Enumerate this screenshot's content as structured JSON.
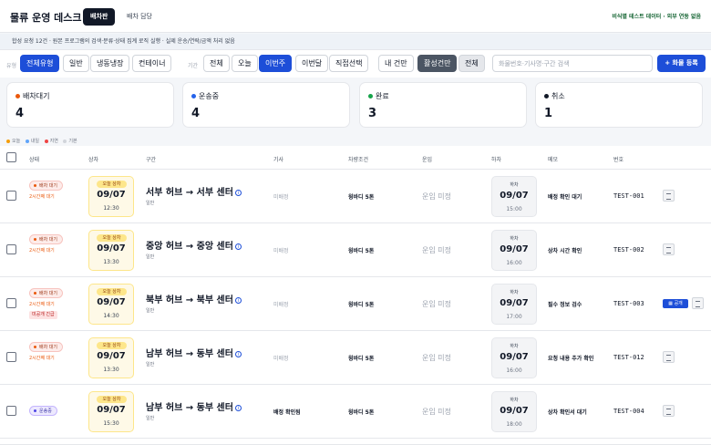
{
  "header": {
    "title": "물류 운영 데스크",
    "tabs": [
      "배차판",
      "배차 담당"
    ],
    "right_text": "비식별 테스트 데이터 · 외부 연동 없음"
  },
  "notice": "합성 요청 12건 · 원본 프로그램의 검색·분류·상태 집계 로직 실행 · 실제 운송/연락/금액 처리 없음",
  "filters": {
    "type_label": "유형",
    "type_options": [
      "전체유형",
      "일반",
      "냉동냉장",
      "컨테이너"
    ],
    "period_label": "기간",
    "period_options": [
      "전체",
      "오늘",
      "이번주",
      "이번달",
      "직접선택"
    ],
    "scope_options": [
      "내 건만",
      "활성건만",
      "전체"
    ],
    "search_placeholder": "화물번호·기사명·구간 검색",
    "add_button": "+ 화물 등록"
  },
  "summary": [
    {
      "label": "배차대기",
      "value": "4",
      "color": "#ea580c"
    },
    {
      "label": "운송중",
      "value": "4",
      "color": "#2563eb"
    },
    {
      "label": "완료",
      "value": "3",
      "color": "#16a34a"
    },
    {
      "label": "취소",
      "value": "1",
      "color": "#111827"
    }
  ],
  "legend": [
    {
      "label": "오늘",
      "color": "#f59e0b"
    },
    {
      "label": "내일",
      "color": "#60a5fa"
    },
    {
      "label": "지연",
      "color": "#ef4444"
    },
    {
      "label": "기본",
      "color": "#d1d5db"
    }
  ],
  "columns": [
    "상태",
    "상차",
    "구간",
    "기사",
    "차량조건",
    "운임",
    "하차",
    "메모",
    "번호"
  ],
  "rows": [
    {
      "status": "배차 대기",
      "elapsed": "2시간째 대기",
      "urgent": "",
      "pickup_tag": "오늘 상차",
      "pickup_date": "09/07",
      "pickup_time": "12:30",
      "route": "서부 허브 → 서부 센터",
      "route_type": "일반",
      "driver": "미배정",
      "vehicle": "윙바디 5톤",
      "fare": "운임 미정",
      "drop_tag": "하차",
      "drop_date": "09/07",
      "drop_time": "15:00",
      "memo": "배정 확인 대기",
      "code": "TEST-001",
      "share": ""
    },
    {
      "status": "배차 대기",
      "elapsed": "2시간째 대기",
      "urgent": "",
      "pickup_tag": "오늘 상차",
      "pickup_date": "09/07",
      "pickup_time": "13:30",
      "route": "중앙 허브 → 중앙 센터",
      "route_type": "일반",
      "driver": "미배정",
      "vehicle": "윙바디 5톤",
      "fare": "운임 미정",
      "drop_tag": "하차",
      "drop_date": "09/07",
      "drop_time": "16:00",
      "memo": "상차 시간 확인",
      "code": "TEST-002",
      "share": ""
    },
    {
      "status": "배차 대기",
      "elapsed": "2시간째 대기",
      "urgent": "미공개 긴급",
      "pickup_tag": "오늘 상차",
      "pickup_date": "09/07",
      "pickup_time": "14:30",
      "route": "북부 허브 → 북부 센터",
      "route_type": "일반",
      "driver": "미배정",
      "vehicle": "윙바디 5톤",
      "fare": "운임 미정",
      "drop_tag": "하차",
      "drop_date": "09/07",
      "drop_time": "17:00",
      "memo": "필수 정보 검수",
      "code": "TEST-003",
      "share": "공개"
    },
    {
      "status": "배차 대기",
      "elapsed": "2시간째 대기",
      "urgent": "",
      "pickup_tag": "오늘 상차",
      "pickup_date": "09/07",
      "pickup_time": "13:30",
      "route": "남부 허브 → 동부 센터",
      "route_type": "일반",
      "driver": "미배정",
      "vehicle": "윙바디 5톤",
      "fare": "운임 미정",
      "drop_tag": "하차",
      "drop_date": "09/07",
      "drop_time": "16:00",
      "memo": "요청 내용 추가 확인",
      "code": "TEST-012",
      "share": ""
    },
    {
      "status": "운송중",
      "elapsed": "",
      "urgent": "",
      "pickup_tag": "오늘 상차",
      "pickup_date": "09/07",
      "pickup_time": "15:30",
      "route": "남부 허브 → 동부 센터",
      "route_type": "일반",
      "driver": "배정 확인됨",
      "vehicle": "윙바디 5톤",
      "fare": "운임 미정",
      "drop_tag": "하차",
      "drop_date": "09/07",
      "drop_time": "18:00",
      "memo": "상차 확인서 대기",
      "code": "TEST-004",
      "share": ""
    }
  ]
}
